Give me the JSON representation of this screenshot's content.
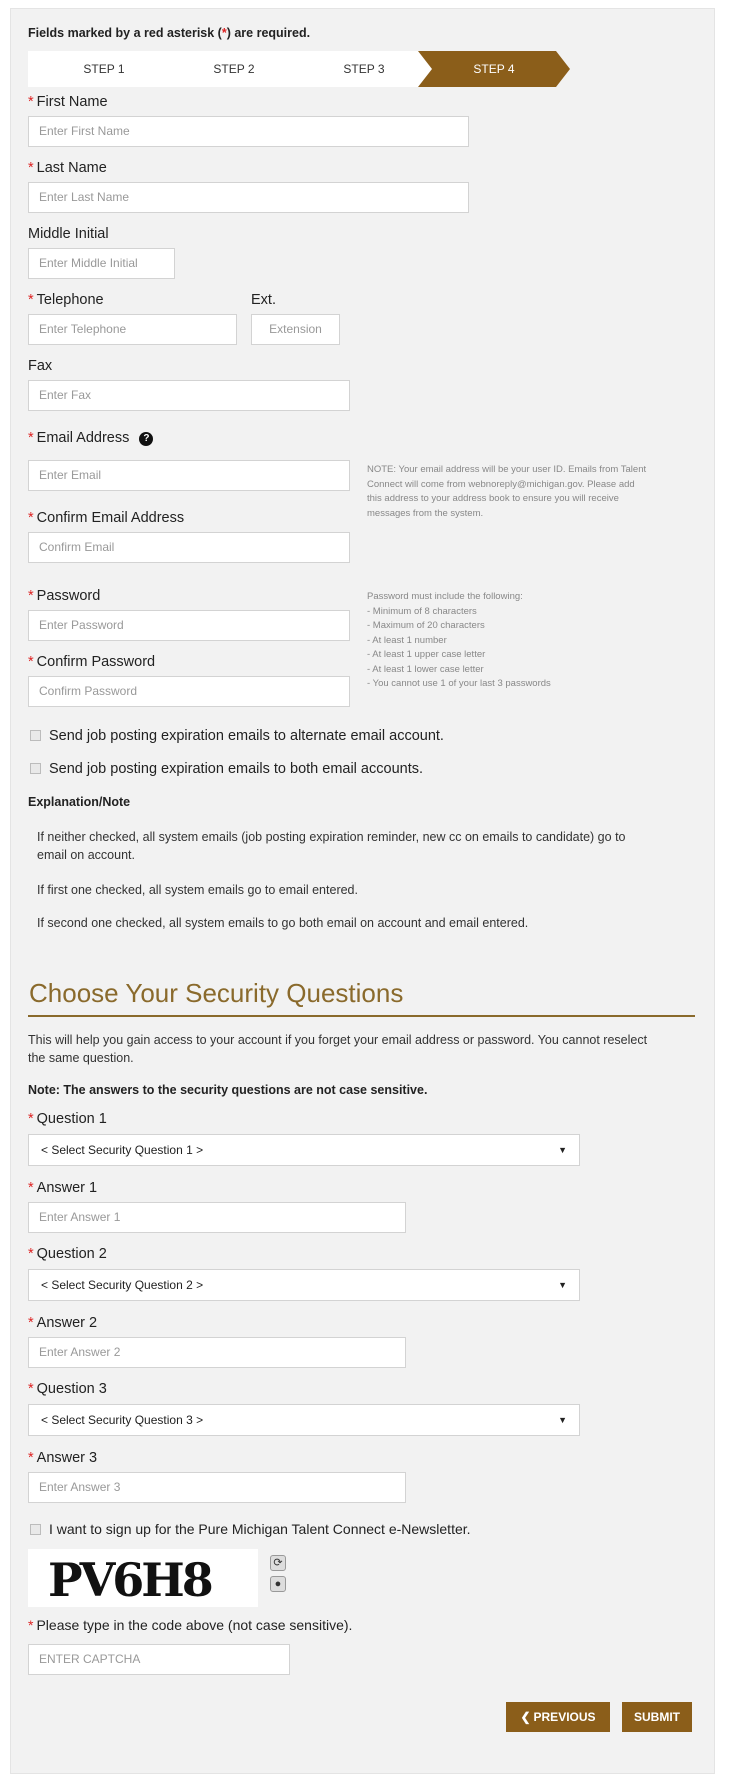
{
  "required_note": {
    "prefix": "Fields marked by a red asterisk (",
    "asterisk": "*",
    "suffix": ") are required."
  },
  "steps": [
    {
      "label": "STEP 1",
      "active": false
    },
    {
      "label": "STEP 2",
      "active": false
    },
    {
      "label": "STEP 3",
      "active": false
    },
    {
      "label": "STEP 4",
      "active": true
    }
  ],
  "asterisk": "*",
  "fields": {
    "first_name": {
      "label": "First Name",
      "placeholder": "Enter First Name"
    },
    "last_name": {
      "label": "Last Name",
      "placeholder": "Enter Last Name"
    },
    "middle_initial": {
      "label": "Middle Initial",
      "placeholder": "Enter Middle Initial"
    },
    "telephone": {
      "label": "Telephone",
      "placeholder": "Enter Telephone"
    },
    "extension": {
      "label": "Ext.",
      "placeholder": "Extension"
    },
    "fax": {
      "label": "Fax",
      "placeholder": "Enter Fax"
    },
    "email": {
      "label": "Email Address",
      "placeholder": "Enter Email"
    },
    "confirm_email": {
      "label": "Confirm Email Address",
      "placeholder": "Confirm Email"
    },
    "password": {
      "label": "Password",
      "placeholder": "Enter Password"
    },
    "confirm_password": {
      "label": "Confirm Password",
      "placeholder": "Confirm Password"
    }
  },
  "email_note": [
    "NOTE: Your email address will be your user ID. Emails from Talent",
    "Connect will come from webnoreply@michigan.gov. Please add",
    "this address to your address book to ensure you will receive",
    "messages from the system."
  ],
  "password_rules": [
    "Password must include the following:",
    "- Minimum of 8 characters",
    "- Maximum of 20 characters",
    "- At least 1 number",
    "- At least 1 upper case letter",
    "- At least 1 lower case letter",
    "- You cannot use 1 of your last 3 passwords"
  ],
  "checkboxes": {
    "alternate": "Send job posting expiration emails to alternate email account.",
    "both": "Send job posting expiration emails to both email accounts."
  },
  "explanation": {
    "title": "Explanation/Note",
    "p1_line1": "If neither checked, all system emails (job posting expiration reminder, new cc on emails to candidate) go to",
    "p1_line2": "email on account.",
    "p2": "If first one checked, all system emails go to email entered.",
    "p3": "If second one checked, all system emails to go both email on account and email entered."
  },
  "security": {
    "heading": "Choose Your Security Questions",
    "intro_line1": "This will help you gain access to your account if you forget your email address or password. You cannot reselect",
    "intro_line2": "the same question.",
    "note": "Note: The answers to the security questions are not case sensitive.",
    "q1_label": "Question 1",
    "q1_value": "< Select Security Question 1 >",
    "a1_label": "Answer 1",
    "a1_placeholder": "Enter Answer 1",
    "q2_label": "Question 2",
    "q2_value": "< Select Security Question 2 >",
    "a2_label": "Answer 2",
    "a2_placeholder": "Enter Answer 2",
    "q3_label": "Question 3",
    "q3_value": "< Select Security Question 3 >",
    "a3_label": "Answer 3",
    "a3_placeholder": "Enter Answer 3",
    "caret": "▼"
  },
  "newsletter": "I want to sign up for the Pure Michigan Talent Connect e-Newsletter.",
  "captcha": {
    "image_text": "PV6H8",
    "label": "Please type in the code above (not case sensitive).",
    "placeholder": "ENTER CAPTCHA",
    "refresh_icon": "refresh-icon",
    "audio_icon": "audio-icon"
  },
  "buttons": {
    "previous_chevron": "❮",
    "previous": "PREVIOUS",
    "submit": "SUBMIT"
  },
  "colors": {
    "accent": "#8b5e1a",
    "heading": "#8a6a2c",
    "required": "#dd2222"
  }
}
